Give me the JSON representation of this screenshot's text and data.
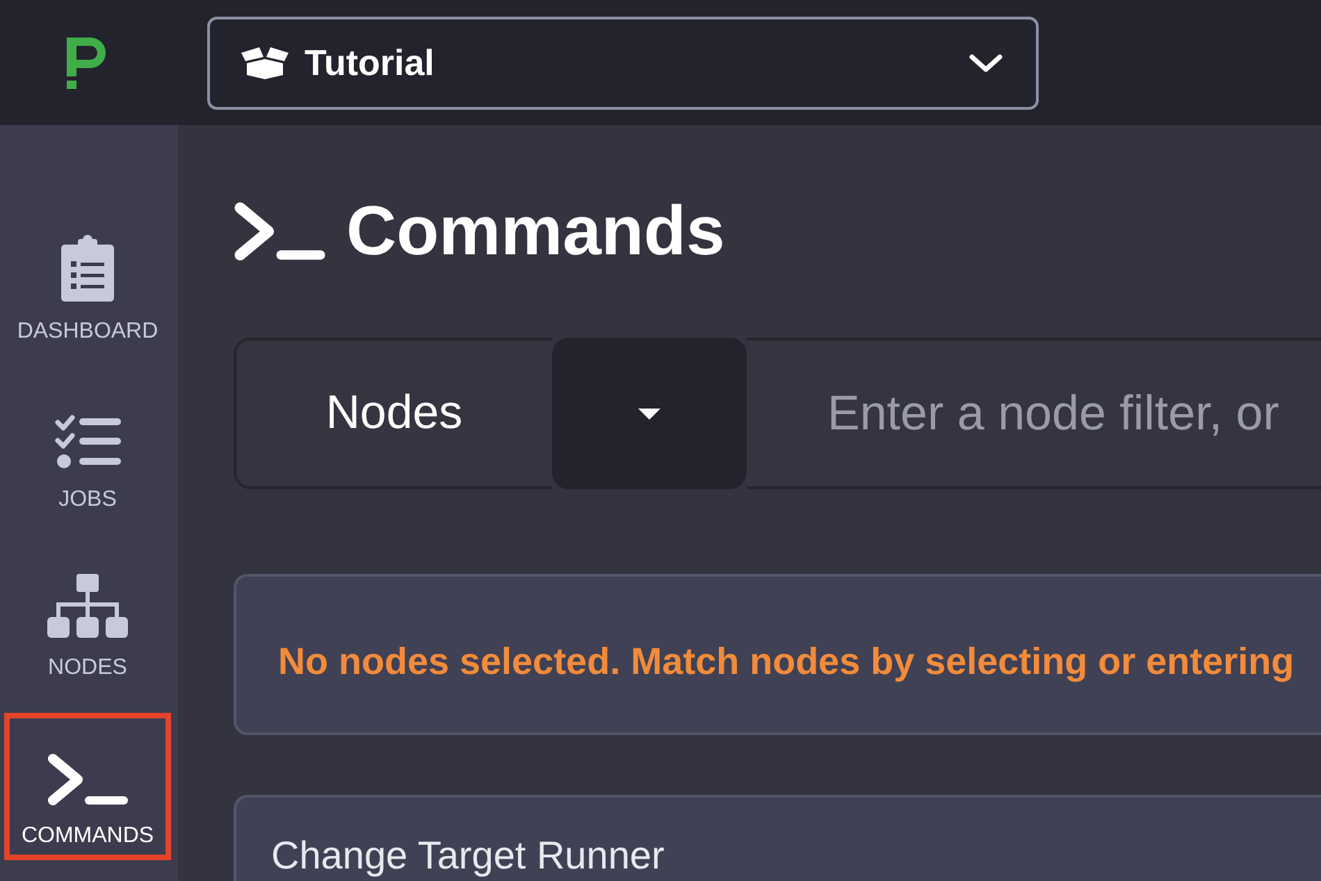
{
  "top_bar": {
    "project_selector": {
      "label": "Tutorial"
    }
  },
  "sidebar": {
    "items": [
      {
        "kind": "dashboard",
        "label": "DASHBOARD",
        "selected": false
      },
      {
        "kind": "jobs",
        "label": "JOBS",
        "selected": false
      },
      {
        "kind": "nodes",
        "label": "NODES",
        "selected": false
      },
      {
        "kind": "commands",
        "label": "COMMANDS",
        "selected": true
      }
    ]
  },
  "page": {
    "title": "Commands"
  },
  "node_filter": {
    "scope_label": "Nodes",
    "placeholder": "Enter a node filter, or"
  },
  "alert": {
    "message": "No nodes selected. Match nodes by selecting or entering"
  },
  "panel": {
    "title": "Change Target Runner"
  }
}
